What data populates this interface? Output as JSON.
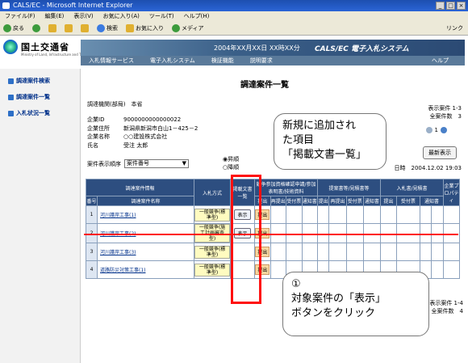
{
  "window": {
    "title": "CALS/EC - Microsoft Internet Explorer",
    "buttons": [
      "_",
      "□",
      "×"
    ]
  },
  "menu": [
    "ファイル(F)",
    "編集(E)",
    "表示(V)",
    "お気に入り(A)",
    "ツール(T)",
    "ヘルプ(H)"
  ],
  "toolbar": {
    "back": "戻る",
    "search": "検索",
    "favorites": "お気に入り",
    "media": "メディア",
    "links": "リンク"
  },
  "site": {
    "ministry": "国土交通省",
    "ministry_en": "Ministry of Land, Infrastructure and Transport",
    "datetime": "2004年XX月XX日 XX時XX分",
    "system": "CALS/EC 電子入札システム",
    "nav": [
      "入札情報サービス",
      "電子入札システム",
      "検証機能",
      "説明要求"
    ],
    "help": "ヘルプ"
  },
  "sidebar": [
    "調達案件検索",
    "調達案件一覧",
    "入札状況一覧"
  ],
  "page": {
    "title": "調達案件一覧",
    "org": "調達機関(部局)　本省",
    "info": [
      {
        "label": "企業ID",
        "value": "9000000000000022"
      },
      {
        "label": "企業住所",
        "value": "新潟県新潟市白山1－425－2"
      },
      {
        "label": "企業名称",
        "value": "○○建設株式会社"
      },
      {
        "label": "氏名",
        "value": "受注 太郎"
      }
    ],
    "counts": {
      "shown": "表示案件 1-3",
      "total": "全案件数　3"
    },
    "pager_page": "1",
    "latest_button": "最新表示",
    "sort_label": "案件表示順序",
    "sort_value": "案件番号",
    "radio_asc": "昇順",
    "radio_desc": "降順",
    "display_time_suffix": "日時",
    "display_time": "2004.12.02 19:03"
  },
  "table": {
    "col_project_info": "調達案件情報",
    "col_no": "番号",
    "col_name": "調達案件名称",
    "col_method": "入札方式",
    "col_notice": "掲載文書一覧",
    "col_group1": "競争参加資格確認申請/参加表明書/技術資料",
    "col_group2": "提案書等/見積書等",
    "col_group3": "入札書/見積書",
    "col_sub1": [
      "提出",
      "再提出",
      "受付票",
      "通知書"
    ],
    "col_sub2": [
      "提出",
      "再提出",
      "受付票",
      "通知書"
    ],
    "col_sub3": [
      "提出",
      "受付票",
      "通知書"
    ],
    "col_last": "企業プロパティ",
    "rows": [
      {
        "no": "1",
        "name": "河川護岸工事(1)",
        "method": "一般競争(標準型)",
        "notice": "表示",
        "status": "提出"
      },
      {
        "no": "2",
        "name": "河川護岸工事(2)",
        "method": "一般競争(施工計画審査型)",
        "notice": "表示",
        "status": "提出"
      },
      {
        "no": "3",
        "name": "河川護岸工事(3)",
        "method": "一般競争(標準型)",
        "notice": "",
        "status": "提出"
      },
      {
        "no": "4",
        "name": "道路防災対策工事(1)",
        "method": "一般競争(標準型)",
        "notice": "",
        "status": "提出"
      }
    ]
  },
  "summary": {
    "shown": "表示案件 1-4",
    "total": "全案件数　4"
  },
  "callouts": {
    "top": [
      "新規に追加され",
      "た項目",
      "「掲載文書一覧」"
    ],
    "bottom": [
      "①",
      "対象案件の「表示」",
      "ボタンをクリック"
    ]
  },
  "colors": {
    "highlight": "#ff1010",
    "header": "#2d4e80",
    "titlebar": "#2a64d6"
  }
}
